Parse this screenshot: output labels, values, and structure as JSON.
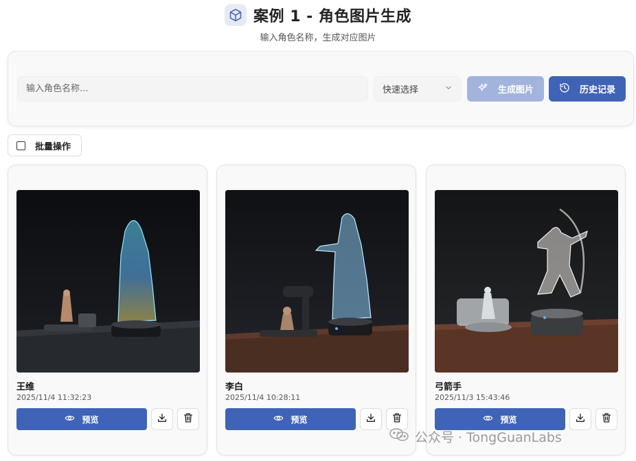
{
  "header": {
    "title": "案例 1 - 角色图片生成",
    "subtitle": "输入角色名称，生成对应图片",
    "logo_icon": "cube-icon"
  },
  "controls": {
    "name_placeholder": "输入角色名称...",
    "quick_select_label": "快速选择",
    "generate_label": "生成图片",
    "history_label": "历史记录"
  },
  "batch": {
    "label": "批量操作"
  },
  "cards": [
    {
      "name": "王维",
      "time": "2025/11/4 11:32:23",
      "preview_label": "预览"
    },
    {
      "name": "李白",
      "time": "2025/11/4 10:28:11",
      "preview_label": "预览"
    },
    {
      "name": "弓箭手",
      "time": "2025/11/3 15:43:46",
      "preview_label": "预览"
    }
  ],
  "watermark": {
    "text": "公众号 · TongGuanLabs"
  },
  "colors": {
    "primary": "#3f63b6",
    "primary_disabled": "#a3b4dc",
    "panel_bg": "#f9f9f9"
  }
}
